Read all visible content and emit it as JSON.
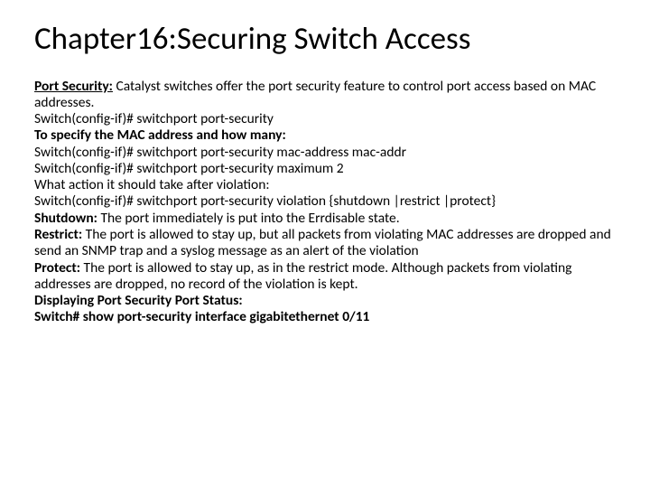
{
  "title": "Chapter16:Securing Switch Access",
  "lines": {
    "l1a": "Port Security:",
    "l1b": " Catalyst switches offer the port security feature to control port access based on MAC addresses.",
    "l2": "Switch(config-if)# switchport port-security",
    "l3": "To specify the MAC address and how many:",
    "l4": "Switch(config-if)# switchport port-security mac-address mac-addr",
    "l5": "Switch(config-if)# switchport port-security maximum 2",
    "l6": "What action it should take after violation:",
    "l7": "Switch(config-if)# switchport port-security violation {shutdown |restrict |protect}",
    "l8a": "Shutdown:",
    "l8b": " The port immediately is put into the Errdisable state.",
    "l9a": "Restrict:",
    "l9b": " The port is allowed to stay up, but all packets from violating MAC addresses are dropped and send an SNMP trap and a syslog message as an alert of the violation",
    "l10a": "Protect:",
    "l10b": " The port is allowed to stay up, as in the restrict mode. Although packets from violating addresses are dropped, no record of the violation is kept.",
    "l11": "Displaying Port Security Port Status:",
    "l12": "Switch# show port-security interface gigabitethernet 0/11"
  }
}
